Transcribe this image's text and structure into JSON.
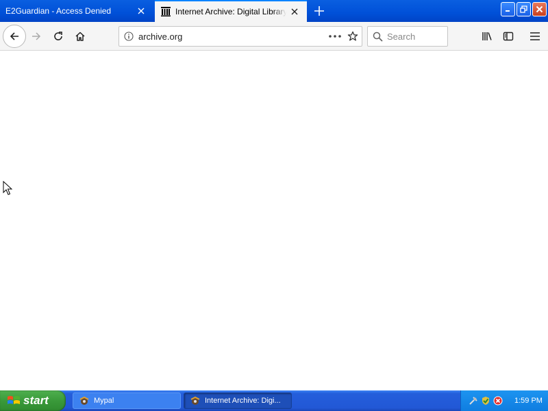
{
  "browser": {
    "tabs": [
      {
        "title": "E2Guardian - Access Denied",
        "active": false
      },
      {
        "title": "Internet Archive: Digital Library of",
        "active": true
      }
    ],
    "address": {
      "url": "archive.org"
    },
    "search": {
      "placeholder": "Search"
    }
  },
  "taskbar": {
    "start_label": "start",
    "items": [
      {
        "label": "Mypal",
        "active": false
      },
      {
        "label": "Internet Archive: Digi...",
        "active": true
      }
    ],
    "clock": "1:59 PM"
  },
  "colors": {
    "titlebar": "#0050d8",
    "toolbar": "#f5f5f5",
    "taskbar": "#245edb",
    "start": "#3a9a3a"
  }
}
